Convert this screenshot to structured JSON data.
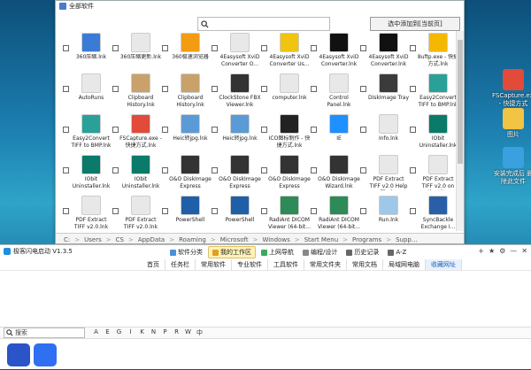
{
  "desktop": {
    "icons": [
      {
        "label": "FSCapture.exe - 快捷方式",
        "color": "#e24a3a"
      },
      {
        "label": "图片",
        "color": "#f3c343"
      },
      {
        "label": "安装完成后 删除此文件",
        "color": "#3aa0e0"
      }
    ]
  },
  "picker": {
    "title": "全部软件",
    "search_placeholder": "",
    "add_button": "选中添加到[当前页]",
    "apps": [
      {
        "label": "360压缩.lnk",
        "color": "#3a7bd5"
      },
      {
        "label": "360压缩更新.lnk",
        "color": "#e8e8e8"
      },
      {
        "label": "360极速浏览器",
        "color": "#f39c12"
      },
      {
        "label": "4Easysoft XviD Converter O...",
        "color": "#e8e8e8"
      },
      {
        "label": "4Easysoft XviD Converter Us...",
        "color": "#f1c40f"
      },
      {
        "label": "4Easysoft XviD Converter.lnk",
        "color": "#111111"
      },
      {
        "label": "4Easysoft XviD Converter.lnk",
        "color": "#111111"
      },
      {
        "label": "8uftp.exe - 快捷方式.lnk",
        "color": "#f5b800"
      },
      {
        "label": "AutoRuns",
        "color": "#e8e8e8"
      },
      {
        "label": "Clipboard History.lnk",
        "color": "#c8a26a"
      },
      {
        "label": "Clipboard History.lnk",
        "color": "#c8a26a"
      },
      {
        "label": "ClockStone FBX Viewer.lnk",
        "color": "#333333"
      },
      {
        "label": "computer.lnk",
        "color": "#e8e8e8"
      },
      {
        "label": "Control Panel.lnk",
        "color": "#e8e8e8"
      },
      {
        "label": "DiskImage Tray",
        "color": "#3b3b3b"
      },
      {
        "label": "Easy2Convert TIFF to BMP.lnk",
        "color": "#2aa198"
      },
      {
        "label": "Easy2Convert TIFF to BMP.lnk",
        "color": "#2aa198"
      },
      {
        "label": "FSCapture.exe - 快捷方式.lnk",
        "color": "#e24a3a"
      },
      {
        "label": "Heic转jpg.lnk",
        "color": "#5b9bd5"
      },
      {
        "label": "Heic转jpg.lnk",
        "color": "#5b9bd5"
      },
      {
        "label": "ICO图标制作 - 快捷方式.lnk",
        "color": "#222222"
      },
      {
        "label": "IE",
        "color": "#1e90ff"
      },
      {
        "label": "Info.lnk",
        "color": "#e8e8e8"
      },
      {
        "label": "IObit Uninstaller.lnk",
        "color": "#0a7a6a"
      },
      {
        "label": "IObit Uninstaller.lnk",
        "color": "#0a7a6a"
      },
      {
        "label": "IObit Uninstaller.lnk",
        "color": "#0a7a6a"
      },
      {
        "label": "O&O DiskImage Express",
        "color": "#333333"
      },
      {
        "label": "O&O DiskImage Express",
        "color": "#333333"
      },
      {
        "label": "O&O DiskImage Express",
        "color": "#333333"
      },
      {
        "label": "O&O DiskImage Wizard.lnk",
        "color": "#333333"
      },
      {
        "label": "PDF Extract TIFF v2.0 Help File.l...",
        "color": "#e8e8e8"
      },
      {
        "label": "PDF Extract TIFF v2.0 on the W...",
        "color": "#e8e8e8"
      },
      {
        "label": "PDF Extract TIFF v2.0.lnk",
        "color": "#e8e8e8"
      },
      {
        "label": "PDF Extract TIFF v2.0.lnk",
        "color": "#e8e8e8"
      },
      {
        "label": "PowerShell",
        "color": "#1f5fa8"
      },
      {
        "label": "PowerShell",
        "color": "#1f5fa8"
      },
      {
        "label": "RadiAnt DICOM Viewer (64-bit...",
        "color": "#2e8b57"
      },
      {
        "label": "RadiAnt DICOM Viewer (64-bit...",
        "color": "#2e8b57"
      },
      {
        "label": "Run.lnk",
        "color": "#9ec7e8"
      },
      {
        "label": "SyncBackle Exchange I...",
        "color": "#2a5fa8"
      }
    ],
    "breadcrumb": [
      "C:",
      "Users",
      "CS",
      "AppData",
      "Roaming",
      "Microsoft",
      "Windows",
      "Start Menu",
      "Programs",
      "Supp..."
    ]
  },
  "main": {
    "title": "极客闪电启动 V1.3.5",
    "topnav": [
      {
        "label": "软件分类",
        "color": "#4a90d9",
        "active": false
      },
      {
        "label": "我的工作区",
        "color": "#e0a020",
        "active": true
      },
      {
        "label": "上网导航",
        "color": "#3aaa5a",
        "active": false
      },
      {
        "label": "编程/设计",
        "color": "#888888",
        "active": false
      },
      {
        "label": "历史记录",
        "color": "#666666",
        "active": false
      },
      {
        "label": "A-Z",
        "color": "#666666",
        "active": false
      }
    ],
    "window_controls": [
      "+",
      "★",
      "⚙",
      "—",
      "✕"
    ],
    "tabs": [
      {
        "label": "首页",
        "active": false
      },
      {
        "label": "任务栏",
        "active": false
      },
      {
        "label": "常用软件",
        "active": false
      },
      {
        "label": "专业软件",
        "active": false
      },
      {
        "label": "工具软件",
        "active": false
      },
      {
        "label": "常用文件夹",
        "active": false
      },
      {
        "label": "常用文档",
        "active": false
      },
      {
        "label": "局域网电脑",
        "active": false
      },
      {
        "label": "收藏网址",
        "active": true
      }
    ],
    "filter": {
      "search_placeholder": "搜索",
      "letters": [
        "A",
        "E",
        "G",
        "I",
        "K",
        "N",
        "P",
        "R",
        "W",
        "中"
      ]
    },
    "dock": [
      {
        "name": "baidu-paw-icon",
        "color": "#2a54c8"
      },
      {
        "name": "wps-office-icon",
        "color": "#2f6ff2"
      }
    ]
  }
}
